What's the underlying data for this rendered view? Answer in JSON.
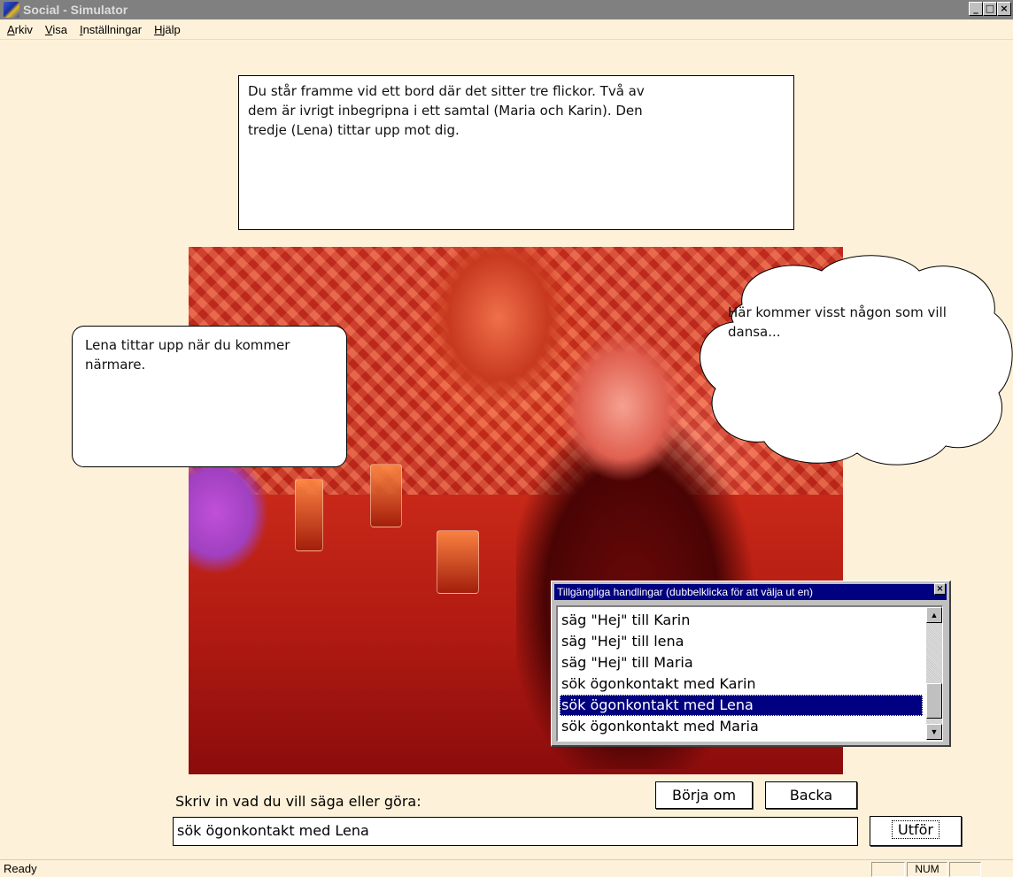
{
  "window": {
    "title": "Social - Simulator",
    "controls": {
      "minimize": "_",
      "maximize": "□",
      "close": "×"
    }
  },
  "menu": {
    "items": [
      {
        "underline": "A",
        "rest": "rkiv"
      },
      {
        "underline": "V",
        "rest": "isa"
      },
      {
        "underline": "I",
        "rest": "nställningar"
      },
      {
        "underline": "H",
        "rest": "jälp"
      }
    ]
  },
  "narration": {
    "text": "Du står framme vid ett bord där det sitter tre flickor. Två av\ndem är ivrigt inbegripna i ett samtal (Maria och Karin). Den\ntredje (Lena) tittar upp mot dig."
  },
  "speech_bubble": {
    "text": "Lena tittar upp när du kommer närmare."
  },
  "thought_bubble": {
    "text": "Här kommer visst någon som vill dansa..."
  },
  "actions_window": {
    "title": "Tillgängliga handlingar (dubbelklicka för att välja ut en)",
    "close": "×",
    "items": [
      "säg \"Hej\" till Karin",
      "säg \"Hej\" till lena",
      "säg \"Hej\" till Maria",
      "sök ögonkontakt med Karin",
      "sök ögonkontakt med Lena",
      "sök ögonkontakt med Maria"
    ],
    "selected_index": 4
  },
  "prompt": {
    "label": "Skriv in vad du vill säga eller göra:",
    "input_value": "sök ögonkontakt med Lena",
    "restart_label": "Börja om",
    "back_label": "Backa",
    "execute_label": "Utför"
  },
  "status": {
    "text": "Ready",
    "num": "NUM"
  }
}
